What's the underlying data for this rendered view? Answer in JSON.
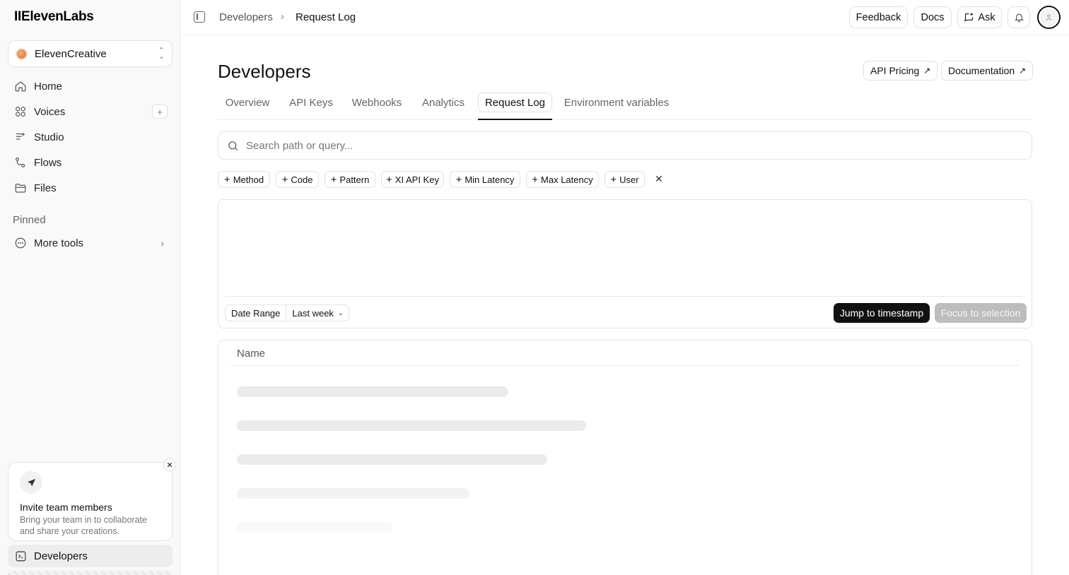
{
  "sidebar": {
    "logo": "IIElevenLabs",
    "workspace": "ElevenCreative",
    "items": [
      {
        "label": "Home",
        "icon": "home-icon"
      },
      {
        "label": "Voices",
        "icon": "voices-icon"
      },
      {
        "label": "Studio",
        "icon": "studio-icon"
      },
      {
        "label": "Flows",
        "icon": "flows-icon"
      },
      {
        "label": "Files",
        "icon": "folder-icon"
      }
    ],
    "voices_add": "+",
    "pinned_label": "Pinned",
    "more_tools": "More tools",
    "invite": {
      "title": "Invite team members",
      "desc": "Bring your team in to collaborate and share your creations.",
      "close": "✕"
    },
    "developers": "Developers"
  },
  "topbar": {
    "breadcrumb": [
      "Developers",
      "Request Log"
    ],
    "breadcrumb_sep": "›",
    "feedback": "Feedback",
    "docs": "Docs",
    "ask": "Ask"
  },
  "main": {
    "title": "Developers",
    "api_pricing": "API Pricing",
    "documentation": "Documentation",
    "external_arrow": "↗",
    "tabs": [
      {
        "label": "Overview"
      },
      {
        "label": "API Keys"
      },
      {
        "label": "Webhooks"
      },
      {
        "label": "Analytics"
      },
      {
        "label": "Request Log",
        "active": true
      },
      {
        "label": "Environment variables"
      }
    ],
    "search_placeholder": "Search path or query...",
    "filters": [
      "Method",
      "Code",
      "Pattern",
      "XI API Key",
      "Min Latency",
      "Max Latency",
      "User"
    ],
    "filter_plus": "+",
    "filter_clear": "✕",
    "date_range_label": "Date Range",
    "date_range_value": "Last week",
    "date_range_chev": "⌄",
    "jump": "Jump to timestamp",
    "focus": "Focus to selection",
    "table_header": "Name"
  },
  "colors": {
    "accent": "#111111",
    "disabled": "#bdbdbd",
    "skeleton": "#ebebeb"
  }
}
